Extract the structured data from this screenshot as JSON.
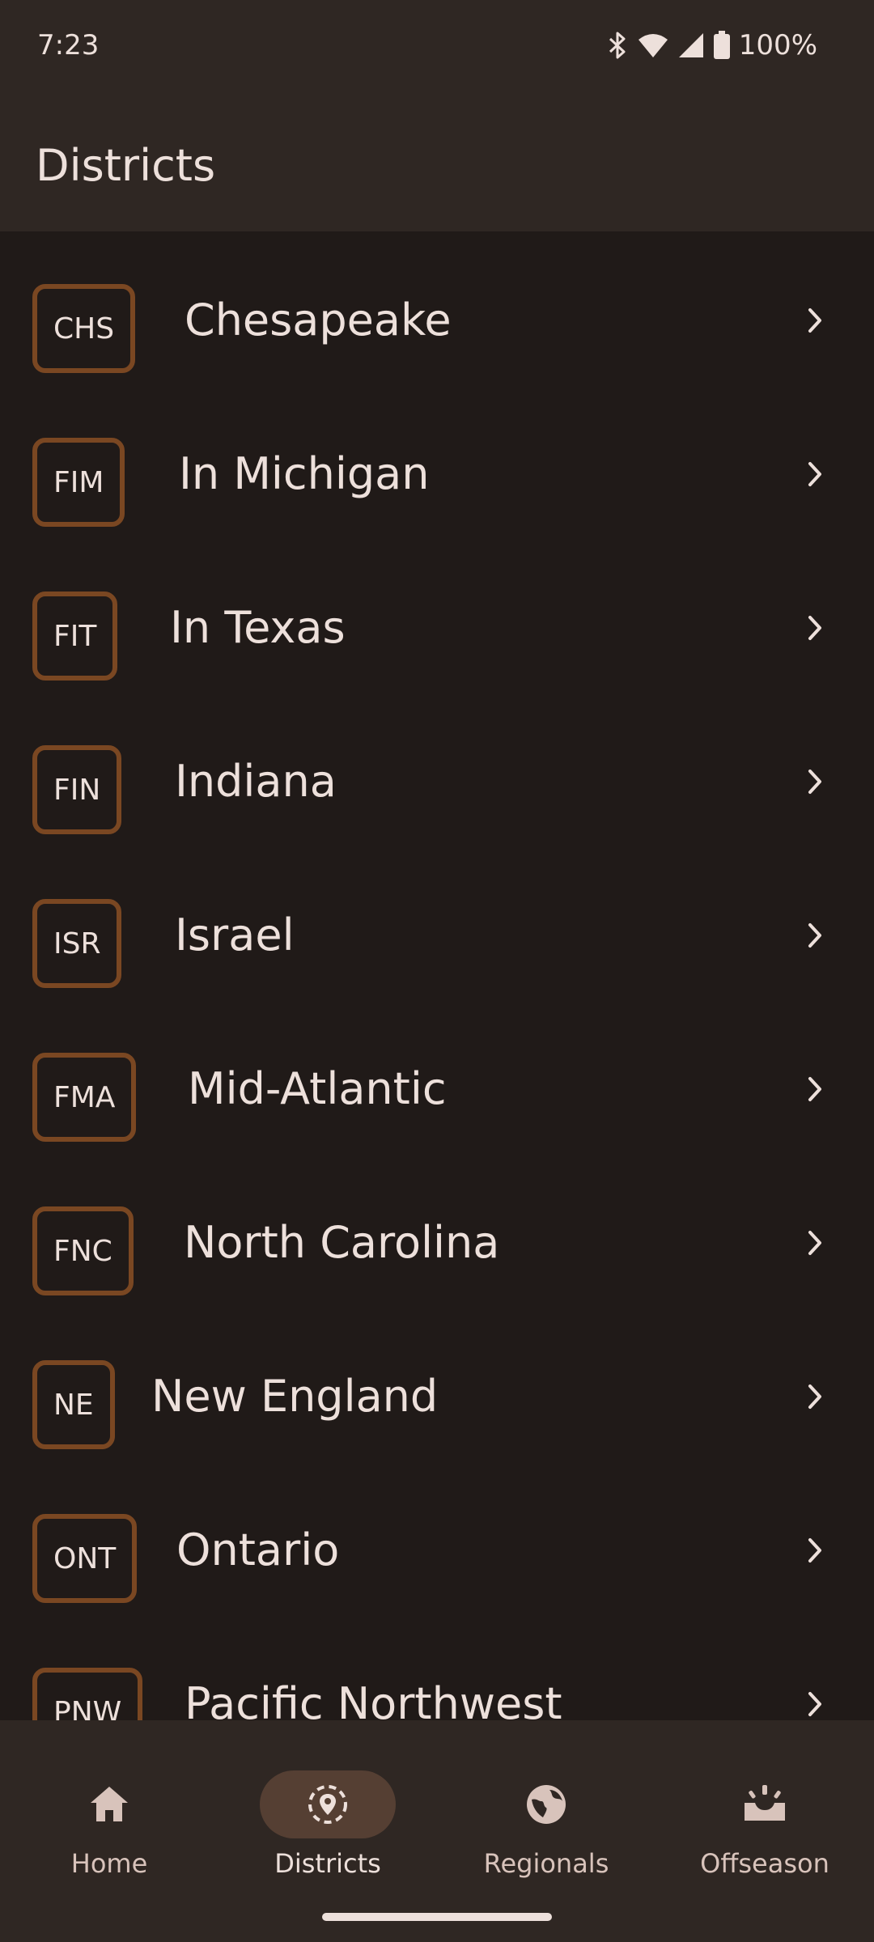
{
  "status_bar": {
    "time": "7:23",
    "battery": "100%",
    "icons": [
      "bluetooth-icon",
      "wifi-icon",
      "signal-icon",
      "battery-icon"
    ]
  },
  "app_bar": {
    "title": "Districts"
  },
  "districts": [
    {
      "code": "CHS",
      "name": "Chesapeake"
    },
    {
      "code": "FIM",
      "name": "In Michigan"
    },
    {
      "code": "FIT",
      "name": "In Texas"
    },
    {
      "code": "FIN",
      "name": "Indiana"
    },
    {
      "code": "ISR",
      "name": "Israel"
    },
    {
      "code": "FMA",
      "name": "Mid-Atlantic"
    },
    {
      "code": "FNC",
      "name": "North Carolina"
    },
    {
      "code": "NE",
      "name": "New England"
    },
    {
      "code": "ONT",
      "name": "Ontario"
    },
    {
      "code": "PNW",
      "name": "Pacific Northwest"
    }
  ],
  "bottom_nav": {
    "items": [
      {
        "label": "Home",
        "icon": "home-icon",
        "active": false
      },
      {
        "label": "Districts",
        "icon": "districts-icon",
        "active": true
      },
      {
        "label": "Regionals",
        "icon": "globe-icon",
        "active": false
      },
      {
        "label": "Offseason",
        "icon": "offseason-icon",
        "active": false
      }
    ]
  },
  "colors": {
    "background": "#201a18",
    "surface": "#2f2723",
    "badge_border": "#7a4722",
    "text": "#ede0db",
    "active_pill": "#553f33"
  }
}
